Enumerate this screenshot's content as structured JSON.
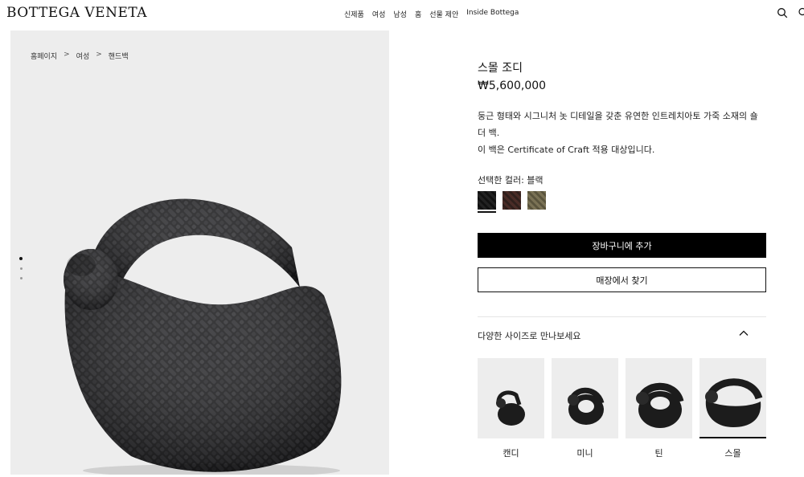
{
  "header": {
    "logo": "BOTTEGA VENETA",
    "nav": [
      "신제품",
      "여성",
      "남성",
      "홈",
      "선물 제안",
      "Inside Bottega"
    ]
  },
  "breadcrumb": [
    "홈페이지",
    "여성",
    "핸드백"
  ],
  "breadcrumb_sep": ">",
  "product": {
    "title": "스몰 조디",
    "price": "₩5,600,000",
    "desc_line1": "둥근 형태와 시그니처 놋 디테일을 갖춘 유연한 인트레치아토 가죽 소재의 숄더 백.",
    "desc_line2": "이 백은 Certificate of Craft 적용 대상입니다.",
    "color_label": "선택한 컬러: 블랙",
    "swatches": [
      {
        "name": "black",
        "color": "#1a1a1a"
      },
      {
        "name": "brown",
        "color": "#3b2420"
      },
      {
        "name": "olive",
        "color": "#6b6449"
      }
    ],
    "add_to_cart": "장바구니에 추가",
    "find_in_store": "매장에서 찾기",
    "sizes_title": "다양한 사이즈로 만나보세요",
    "sizes": [
      "캔디",
      "미니",
      "틴",
      "스몰"
    ],
    "selected_size_index": 3
  },
  "colors": {
    "accent": "#000000",
    "panel": "#ededed"
  }
}
